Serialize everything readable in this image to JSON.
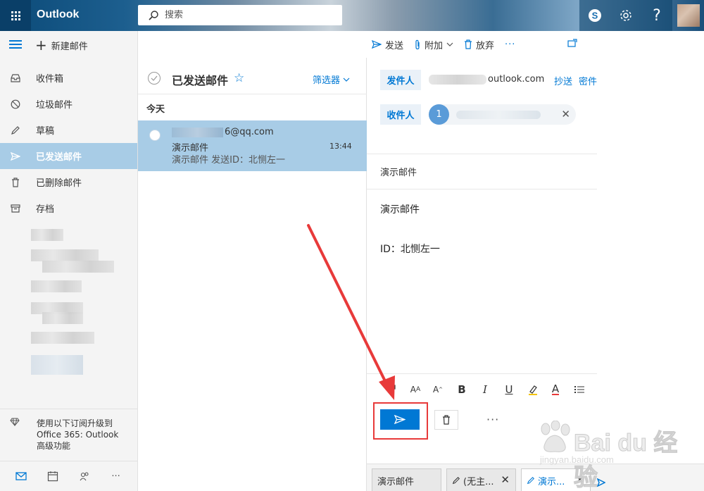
{
  "app": {
    "brand": "Outlook"
  },
  "search": {
    "placeholder": "搜索"
  },
  "toolbar": {
    "new_mail": "新建邮件"
  },
  "compose_toolbar": {
    "send": "发送",
    "attach": "附加",
    "discard": "放弃"
  },
  "nav": {
    "items": [
      {
        "label": "收件箱",
        "icon": "inbox-icon"
      },
      {
        "label": "垃圾邮件",
        "icon": "junk-icon"
      },
      {
        "label": "草稿",
        "icon": "pencil-icon"
      },
      {
        "label": "已发送邮件",
        "icon": "sent-icon",
        "active": true
      },
      {
        "label": "已删除邮件",
        "icon": "trash-icon"
      },
      {
        "label": "存档",
        "icon": "archive-icon"
      }
    ]
  },
  "upgrade": {
    "text": "使用以下订阅升级到 Office 365: Outlook 高级功能"
  },
  "list": {
    "title": "已发送邮件",
    "filter": "筛选器",
    "group_label": "今天",
    "messages": [
      {
        "sender_suffix": "6@qq.com",
        "subject": "演示邮件",
        "time": "13:44",
        "preview": "演示邮件 发送ID：北恻左一"
      }
    ]
  },
  "compose": {
    "from_label": "发件人",
    "from_domain": "outlook.com",
    "cc": "抄送",
    "bcc": "密件",
    "to_label": "收件人",
    "to_chip_initial": "1",
    "subject": "演示邮件",
    "body_line1": "演示邮件",
    "body_line2": "ID：北恻左一"
  },
  "drafts": [
    {
      "label": "演示邮件",
      "active": false,
      "icon": ""
    },
    {
      "label": "(无主...",
      "active": false,
      "icon": "pencil-icon"
    },
    {
      "label": "演示...",
      "active": true,
      "icon": "pencil-icon"
    }
  ],
  "watermark": {
    "text": "Bai du 经验",
    "sub": "jingyan.baidu.com"
  },
  "colors": {
    "accent": "#0078d4",
    "selected": "#a8cce6",
    "annotation": "#e83a3a"
  }
}
